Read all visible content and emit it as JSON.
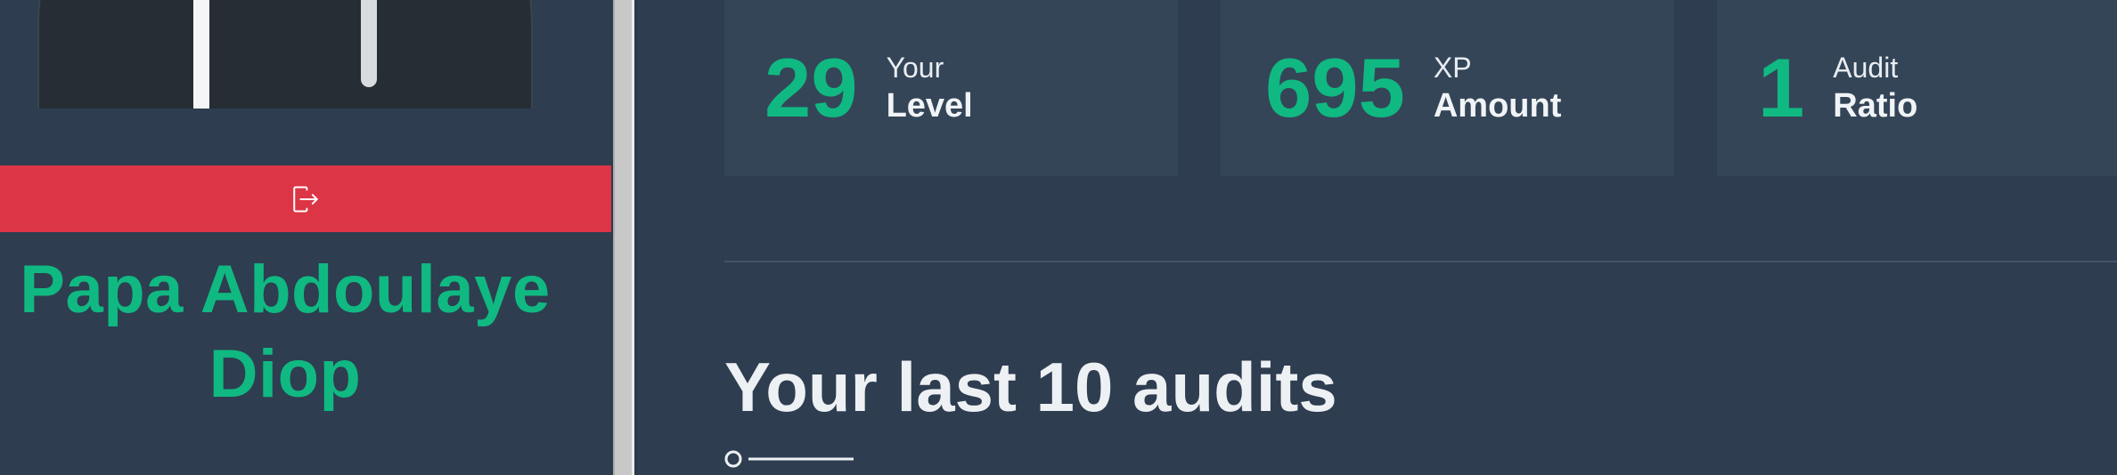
{
  "sidebar": {
    "user": {
      "name_first_line": "Papa Abdoulaye",
      "name_second_line": "Diop"
    },
    "logout": {
      "icon": "logout-icon"
    }
  },
  "stats": [
    {
      "value": "29",
      "caption": "Your",
      "label": "Level"
    },
    {
      "value": "695",
      "caption": "XP",
      "label": "Amount"
    },
    {
      "value": "1",
      "caption": "Audit",
      "label": "Ratio"
    }
  ],
  "audits": {
    "title": "Your last 10 audits"
  },
  "colors": {
    "background": "#2e3d50",
    "card": "#344558",
    "accent": "#10b981",
    "logout": "#dc3545"
  }
}
